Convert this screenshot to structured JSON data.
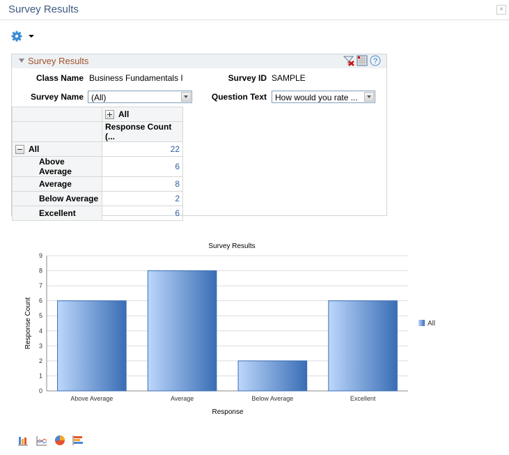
{
  "window": {
    "title": "Survey Results",
    "close_label": "×"
  },
  "toolbar": {
    "gear_icon": "gear-icon",
    "menu_caret": "caret-down-icon"
  },
  "panel": {
    "title": "Survey Results",
    "header_icons": [
      "clear-filter-icon",
      "grid-icon",
      "help-icon"
    ],
    "filters": {
      "class_name_label": "Class Name",
      "class_name_value": "Business Fundamentals I",
      "survey_id_label": "Survey ID",
      "survey_id_value": "SAMPLE",
      "survey_name_label": "Survey Name",
      "survey_name_value": "(All)",
      "question_text_label": "Question Text",
      "question_text_value": "How would you rate ..."
    },
    "pivot": {
      "column_group": "All",
      "column_header": "Response Count (...",
      "total_label": "All",
      "total_value": "22",
      "rows": [
        {
          "label": "Above Average",
          "value": "6"
        },
        {
          "label": "Average",
          "value": "8"
        },
        {
          "label": "Below Average",
          "value": "2"
        },
        {
          "label": "Excellent",
          "value": "6"
        }
      ]
    }
  },
  "chart_data": {
    "type": "bar",
    "title": "Survey Results",
    "xlabel": "Response",
    "ylabel": "Response Count",
    "categories": [
      "Above Average",
      "Average",
      "Below Average",
      "Excellent"
    ],
    "series": [
      {
        "name": "All",
        "values": [
          6,
          8,
          2,
          6
        ]
      }
    ],
    "ylim": [
      0,
      9
    ],
    "yticks": [
      "0",
      "1",
      "2",
      "3",
      "4",
      "5",
      "6",
      "7",
      "8",
      "9"
    ],
    "grid": true,
    "legend": "right"
  },
  "chart_types": [
    "bar-chart-icon",
    "line-chart-icon",
    "pie-chart-icon",
    "horizontal-bar-chart-icon"
  ]
}
